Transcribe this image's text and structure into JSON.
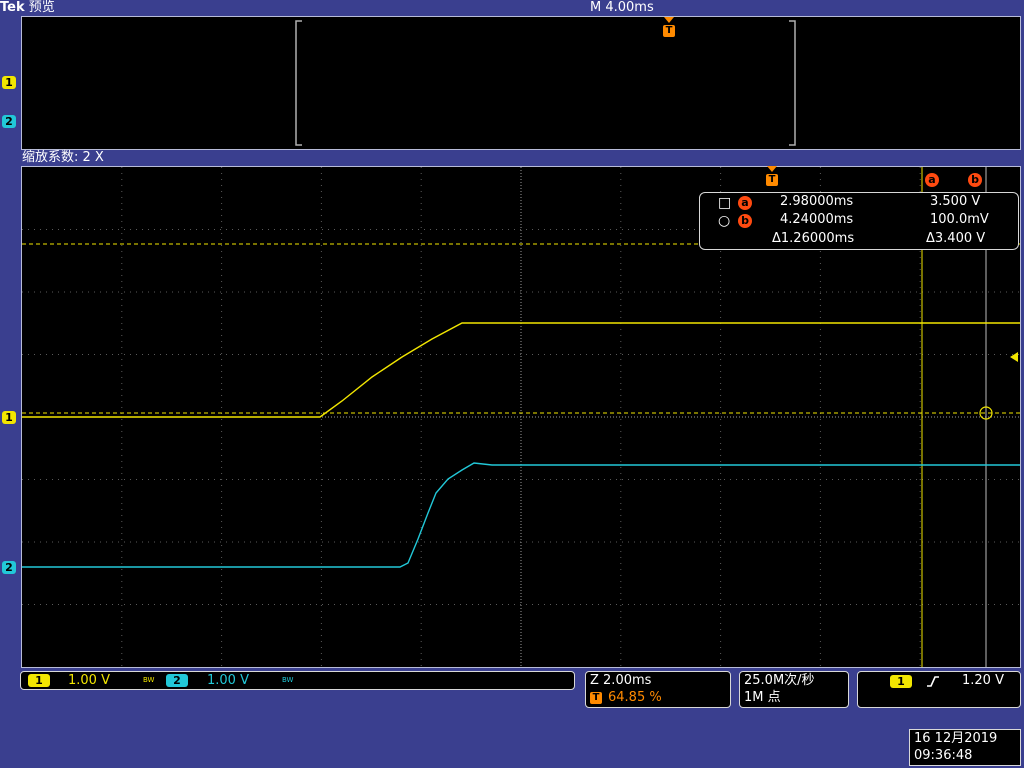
{
  "header": {
    "brand": "Tek",
    "mode": "预览",
    "timebase": "M 4.00ms"
  },
  "zoom": {
    "label": "缩放系数: 2 X"
  },
  "overview": {
    "trigger_marker": "T",
    "channel_markers": [
      "1",
      "2"
    ]
  },
  "main_display": {
    "channel_markers": [
      "1",
      "2"
    ],
    "trigger_marker": "T",
    "cursor_markers": [
      "a",
      "b"
    ]
  },
  "cursor_readout": {
    "rows": [
      {
        "symbol": "□",
        "cursor": "a",
        "time": "2.98000ms",
        "value": "3.500 V"
      },
      {
        "symbol": "○",
        "cursor": "b",
        "time": "4.24000ms",
        "value": "100.0mV"
      }
    ],
    "delta_time": "Δ1.26000ms",
    "delta_value": "Δ3.400 V"
  },
  "status_bar": {
    "ch1": {
      "num": "1",
      "scale": "1.00 V",
      "bw": "BW"
    },
    "ch2": {
      "num": "2",
      "scale": "1.00 V",
      "bw": "BW"
    },
    "zoom_scale": "Z 2.00ms",
    "trigger_marker": "T",
    "trigger_position": "64.85 %",
    "sample_rate": "25.0M次/秒",
    "record_length": "1M 点",
    "trigger_channel": "1",
    "trigger_slope_icon": "rising-edge-icon",
    "trigger_level": "1.20 V"
  },
  "datetime": {
    "date": "16 12月2019",
    "time": "09:36:48"
  },
  "colors": {
    "ch1": "#f2e600",
    "ch2": "#22c8d8",
    "trigger": "#ff8a00",
    "cursor": "#ff4a10",
    "background": "#3a3f8f"
  }
}
